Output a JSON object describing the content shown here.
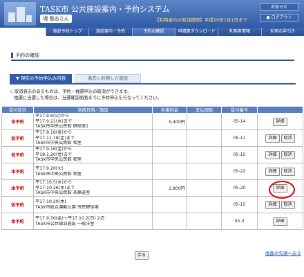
{
  "header": {
    "title": "TASK市 公共施設案内・予約システム",
    "user": "堀 敬志さん",
    "notice": "【利用者IDの有効期限】平成20年1月1日まで",
    "home_btn": "お知らせ",
    "logout_btn": "● ログアウト"
  },
  "nav": [
    "施設予約トップ",
    "施設案内・予約",
    "予約の確認",
    "申請書ダウンロード",
    "利用者情報",
    "利用の手引き"
  ],
  "page": {
    "section_title": "予約の確認",
    "tab_current": "▼ 現在の予約申込み内容",
    "tab_past": "過去に利用した施設",
    "note1": "◇ 取消表示のあるものは、予約・抽選申込の取消ができます。",
    "note2": "　抽選に当選した場合は、当選確認画面までに予約申込を行なってください。",
    "back_btn": "戻る",
    "back_link": "画面の先頭へ戻る"
  },
  "table": {
    "headers": [
      "受付状況",
      "利用日時／施設",
      "利用料金",
      "支払期限",
      "受付番号",
      ""
    ],
    "rows": [
      {
        "status": "本予約",
        "lines": [
          "平17.9.6(火)から",
          "平17.9.21(水)まで",
          "TASK市中央公民館 研修室1"
        ],
        "fee": "5,400円",
        "due": "",
        "number": "05-14",
        "actions": [
          "詳細"
        ],
        "highlight": false
      },
      {
        "status": "仮予約",
        "lines": [
          "平17.9.16(金)から",
          "平17.11.18(金)まで",
          "TASK市中央公民館 和室"
        ],
        "fee": "",
        "due": "",
        "number": "05-11",
        "actions": [
          "詳細",
          "取消"
        ],
        "highlight": false
      },
      {
        "status": "仮予約",
        "lines": [
          "平17.9.16(金)から",
          "平18.1.20(金)まで",
          "TASK市中央公民館 和室"
        ],
        "fee": "",
        "due": "",
        "number": "05-15",
        "actions": [
          "詳細",
          "取消"
        ],
        "highlight": false
      },
      {
        "status": "本予約",
        "lines": [
          "平17.9.20(火)",
          "TASK市中央公民館 和室"
        ],
        "fee": "",
        "due": "",
        "number": "05-22",
        "actions": [
          "詳細",
          "取消"
        ],
        "highlight": false
      },
      {
        "status": "本予約",
        "lines": [
          "平17.10.5(水)から",
          "平17.10.26(水)まで",
          "TASK市中央公民館 茶華道室"
        ],
        "fee": "2,800円",
        "due": "",
        "number": "05-20",
        "actions": [
          "詳細"
        ],
        "highlight": true
      },
      {
        "status": "仮予約",
        "lines": [
          "平17.10.20(木)",
          "TASK市総合運動公園 市民野球場"
        ],
        "fee": "",
        "due": "",
        "number": "05-15",
        "actions": [
          "詳細",
          "取消"
        ],
        "highlight": false
      },
      {
        "status": "本予約",
        "lines": [
          "平17.9.30(金)〜平17.10.2(日) 2泊",
          "TASK市公共宿泊施設 一般洋室"
        ],
        "fee": "",
        "due": "",
        "number": "05-3",
        "actions": [
          "詳細"
        ],
        "highlight": false
      }
    ]
  }
}
